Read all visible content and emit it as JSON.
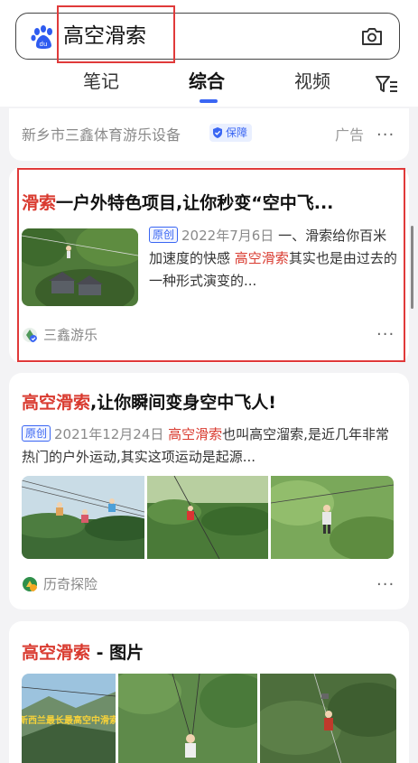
{
  "search": {
    "query": "高空滑索"
  },
  "tabs": [
    {
      "label": "笔记"
    },
    {
      "label": "综合"
    },
    {
      "label": "视频"
    }
  ],
  "active_tab": "综合",
  "ad": {
    "advertiser": "新乡市三鑫体育游乐设备",
    "guarantee_badge": "保障",
    "label": "广告"
  },
  "result1": {
    "title_keyword": "滑索",
    "title_rest": "一户外特色项目,让你秒变“空中飞...",
    "original_badge": "原创",
    "date": "2022年7月6日",
    "snippet_part1": "一、滑索给你百米加速度的快感",
    "snippet_keyword": "高空滑索",
    "snippet_part2": "其实也是由过去的一种形式演变的...",
    "source": "三鑫游乐"
  },
  "result2": {
    "title_keyword": "高空滑索",
    "title_rest": ",让你瞬间变身空中飞人!",
    "original_badge": "原创",
    "date": "2021年12月24日",
    "snippet_keyword": "高空滑索",
    "snippet_part1": "也叫高空溜索,是近几年非常热门的户外运动,其实这项运动是起源...",
    "source": "历奇探险"
  },
  "result3": {
    "title_keyword": "高空滑索",
    "title_rest": " - 图片",
    "image1_caption": "新西兰最长最高空中滑索"
  },
  "colors": {
    "accent": "#3a66f3",
    "keyword_red": "#d93a2f",
    "highlight_box": "#e03a3a"
  }
}
